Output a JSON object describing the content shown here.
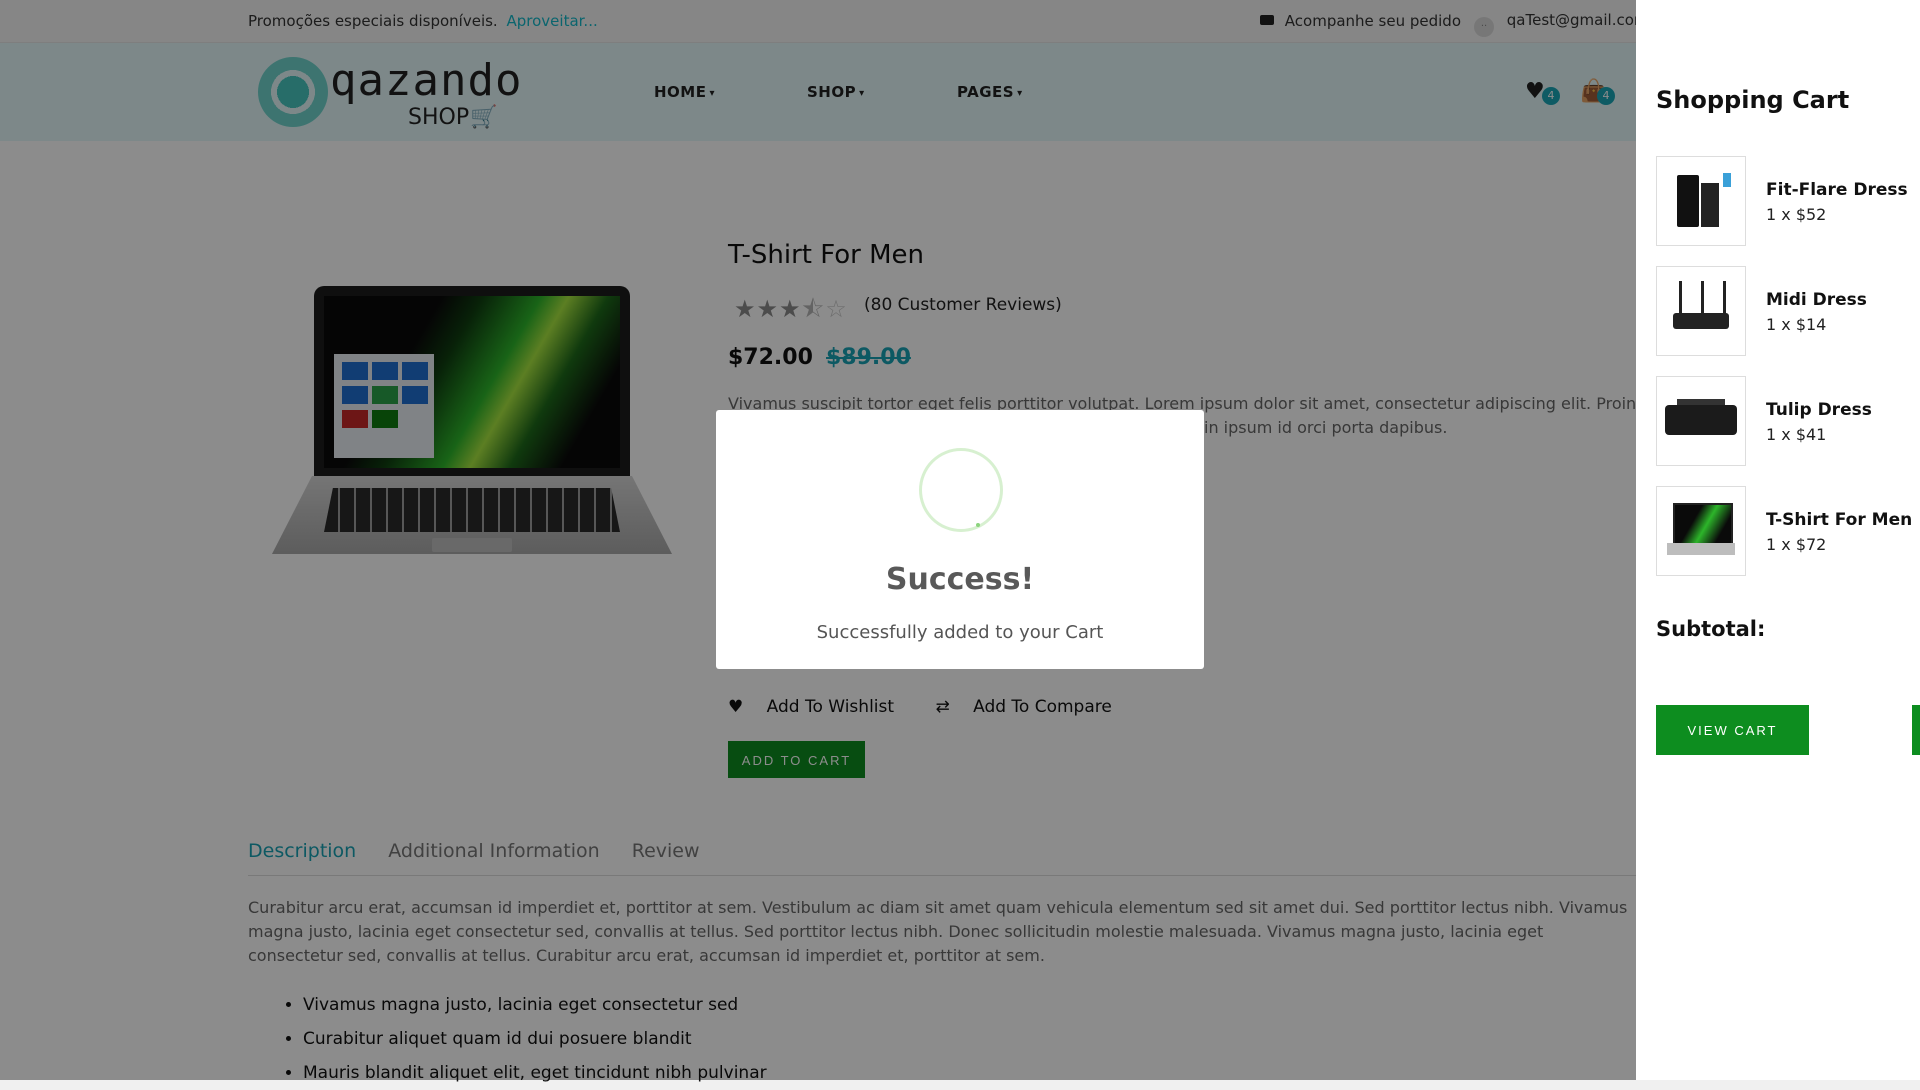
{
  "topbar": {
    "promo_text": "Promoções especiais disponíveis.",
    "promo_link": "Aproveitar...",
    "track_order": "Acompanhe seu pedido",
    "user_email": "qaTest@gmail.com"
  },
  "header": {
    "logo_word": "qazando",
    "logo_sub": "SHOP",
    "nav": [
      "HOME",
      "SHOP",
      "PAGES"
    ],
    "wishlist_count": "4",
    "cart_count": "4"
  },
  "product": {
    "title": "T-Shirt For Men",
    "rating": 3.5,
    "rating_max": 5,
    "reviews": "(80 Customer Reviews)",
    "price": "$72.00",
    "old_price": "$89.00",
    "desc_line1": "Vivamus suscipit tortor eget felis porttitor volutpat. Lorem ipsum dolor sit amet, consectetur adipiscing elit. Proin eget",
    "desc_line2": "in ipsum id orci porta dapibus.",
    "wishlist_link": "Add To Wishlist",
    "compare_link": "Add To Compare",
    "add_to_cart": "ADD TO CART"
  },
  "tabs": {
    "items": [
      "Description",
      "Additional Information",
      "Review"
    ],
    "active": "Description",
    "description": "Curabitur arcu erat, accumsan id imperdiet et, porttitor at sem. Vestibulum ac diam sit amet quam vehicula elementum sed sit amet dui. Sed porttitor lectus nibh. Vivamus magna justo, lacinia eget consectetur sed, convallis at tellus. Sed porttitor lectus nibh. Donec sollicitudin molestie malesuada. Vivamus magna justo, lacinia eget consectetur sed, convallis at tellus. Curabitur arcu erat, accumsan id imperdiet et, porttitor at sem.",
    "bullets": [
      "Vivamus magna justo, lacinia eget consectetur sed",
      "Curabitur aliquet quam id dui posuere blandit",
      "Mauris blandit aliquet elit, eget tincidunt nibh pulvinar"
    ]
  },
  "modal": {
    "title": "Success!",
    "message": "Successfully added to your Cart"
  },
  "cart": {
    "heading": "Shopping Cart",
    "items": [
      {
        "name": "Fit-Flare Dress",
        "qty": "1 x $52"
      },
      {
        "name": "Midi Dress",
        "qty": "1 x $14"
      },
      {
        "name": "Tulip Dress",
        "qty": "1 x $41"
      },
      {
        "name": "T-Shirt For Men",
        "qty": "1 x $72"
      }
    ],
    "subtotal_label": "Subtotal:",
    "view_cart": "VIEW CART"
  },
  "colors": {
    "accent": "#19a3b4",
    "button_green": "#0d8d1f",
    "header_bg": "#e3f8fa"
  }
}
